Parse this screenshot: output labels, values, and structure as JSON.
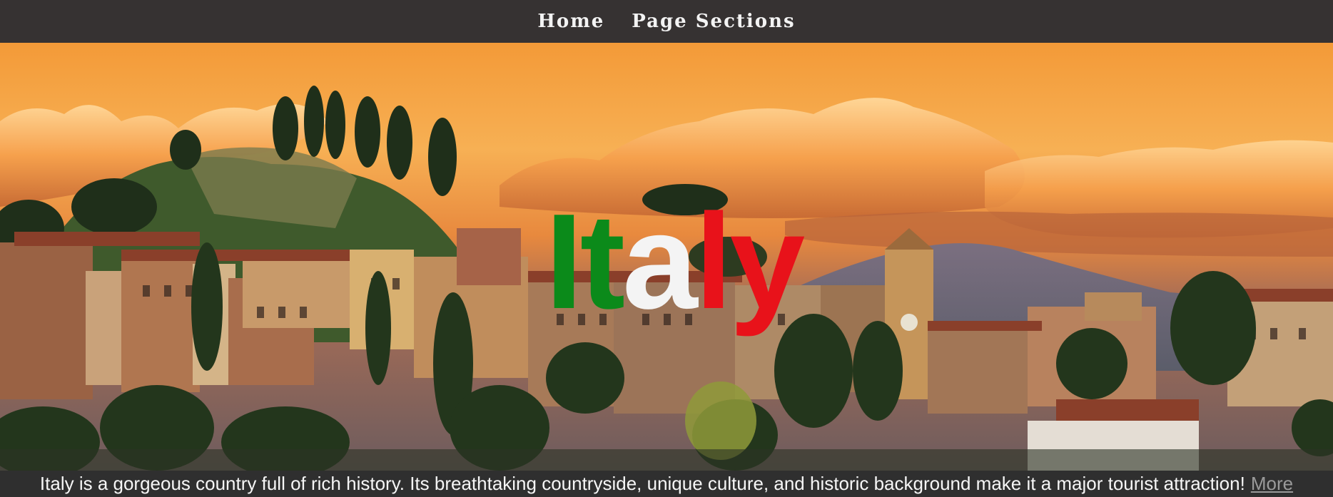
{
  "nav": {
    "home_label": "Home",
    "sections_label": "Page Sections"
  },
  "hero": {
    "title_part1": "It",
    "title_part2": "a",
    "title_part3": "ly",
    "colors": {
      "green": "#0b8a1a",
      "white": "#f4f4f4",
      "red": "#e8121a"
    }
  },
  "caption": {
    "text": "Italy is a gorgeous country full of rich history. Its breathtaking countryside, unique culture, and historic background make it a major tourist attraction!",
    "more_label": "More"
  }
}
